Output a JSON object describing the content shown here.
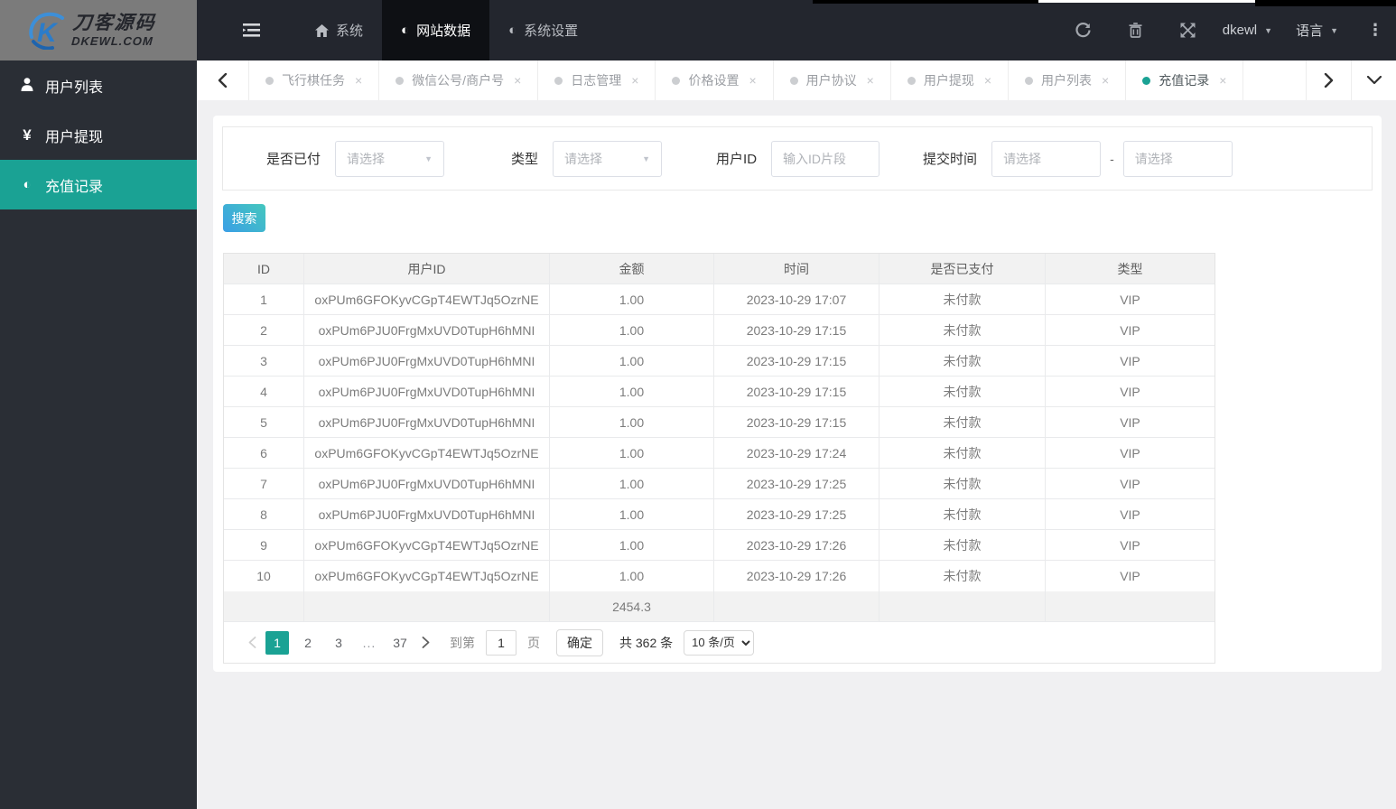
{
  "colors": {
    "accent": "#1aa294",
    "search_gradient_start": "#44c7be",
    "search_gradient_end": "#3b9fe6"
  },
  "icons": {
    "caret_down": "▼",
    "dots_vertical": "⋮",
    "close": "×",
    "half_circle": "◐",
    "yen": "¥",
    "dash": "-"
  },
  "topbar": {
    "logo_title": "刀客源码",
    "logo_subtitle": "DKEWL.COM",
    "menu": [
      {
        "label": "系统"
      },
      {
        "label": "网站数据",
        "active": true
      },
      {
        "label": "系统设置"
      }
    ],
    "username": "dkewl",
    "language": "语言"
  },
  "tabbar": {
    "tabs": [
      {
        "label": "飞行棋任务"
      },
      {
        "label": "微信公号/商户号"
      },
      {
        "label": "日志管理"
      },
      {
        "label": "价格设置"
      },
      {
        "label": "用户协议"
      },
      {
        "label": "用户提现"
      },
      {
        "label": "用户列表"
      },
      {
        "label": "充值记录",
        "active": true
      }
    ]
  },
  "sidebar": {
    "items": [
      {
        "label": "用户列表"
      },
      {
        "label": "用户提现"
      },
      {
        "label": "充值记录",
        "active": true
      }
    ]
  },
  "filters": {
    "paid": {
      "label": "是否已付",
      "value": "请选择"
    },
    "type": {
      "label": "类型",
      "value": "请选择"
    },
    "user_id": {
      "label": "用户ID",
      "placeholder": "输入ID片段"
    },
    "submit_time": {
      "label": "提交时间",
      "start_placeholder": "请选择",
      "end_placeholder": "请选择"
    }
  },
  "search_button": "搜索",
  "table": {
    "headers": [
      "ID",
      "用户ID",
      "金额",
      "时间",
      "是否已支付",
      "类型"
    ],
    "rows": [
      [
        "1",
        "oxPUm6GFOKyvCGpT4EWTJq5OzrNE",
        "1.00",
        "2023-10-29 17:07",
        "未付款",
        "VIP"
      ],
      [
        "2",
        "oxPUm6PJU0FrgMxUVD0TupH6hMNI",
        "1.00",
        "2023-10-29 17:15",
        "未付款",
        "VIP"
      ],
      [
        "3",
        "oxPUm6PJU0FrgMxUVD0TupH6hMNI",
        "1.00",
        "2023-10-29 17:15",
        "未付款",
        "VIP"
      ],
      [
        "4",
        "oxPUm6PJU0FrgMxUVD0TupH6hMNI",
        "1.00",
        "2023-10-29 17:15",
        "未付款",
        "VIP"
      ],
      [
        "5",
        "oxPUm6PJU0FrgMxUVD0TupH6hMNI",
        "1.00",
        "2023-10-29 17:15",
        "未付款",
        "VIP"
      ],
      [
        "6",
        "oxPUm6GFOKyvCGpT4EWTJq5OzrNE",
        "1.00",
        "2023-10-29 17:24",
        "未付款",
        "VIP"
      ],
      [
        "7",
        "oxPUm6PJU0FrgMxUVD0TupH6hMNI",
        "1.00",
        "2023-10-29 17:25",
        "未付款",
        "VIP"
      ],
      [
        "8",
        "oxPUm6PJU0FrgMxUVD0TupH6hMNI",
        "1.00",
        "2023-10-29 17:25",
        "未付款",
        "VIP"
      ],
      [
        "9",
        "oxPUm6GFOKyvCGpT4EWTJq5OzrNE",
        "1.00",
        "2023-10-29 17:26",
        "未付款",
        "VIP"
      ],
      [
        "10",
        "oxPUm6GFOKyvCGpT4EWTJq5OzrNE",
        "1.00",
        "2023-10-29 17:26",
        "未付款",
        "VIP"
      ]
    ],
    "summary_amount": "2454.3"
  },
  "pagination": {
    "pages": [
      {
        "label": "1",
        "active": true
      },
      {
        "label": "2"
      },
      {
        "label": "3"
      },
      {
        "label": "...",
        "ellipsis": true
      },
      {
        "label": "37"
      }
    ],
    "goto_label": "到第",
    "goto_value": "1",
    "page_unit": "页",
    "confirm_label": "确定",
    "total_label": "共 362 条",
    "page_size": "10 条/页"
  }
}
